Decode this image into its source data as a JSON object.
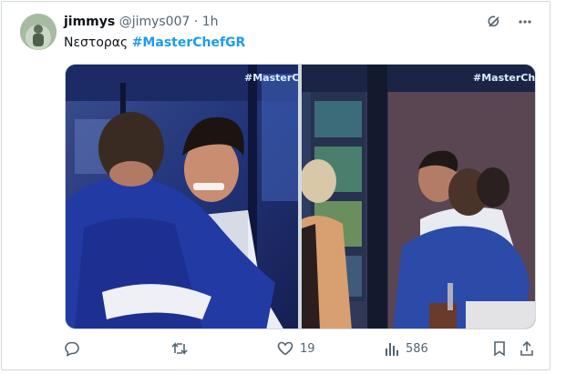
{
  "tweet": {
    "display_name": "jimmys",
    "handle": "@jimys007",
    "separator": "·",
    "time": "1h",
    "text_plain": "Νεστορας ",
    "hashtag": "#MasterChefGR"
  },
  "media": {
    "watermark_left": "#MasterCh",
    "watermark_right": "#MasterChef"
  },
  "actions": {
    "likes": "19",
    "views": "586"
  },
  "icons": {
    "reply": "speech-bubble-icon",
    "retweet": "retweet-icon",
    "like": "heart-icon",
    "views": "bar-chart-icon",
    "bookmark": "bookmark-icon",
    "share": "share-icon",
    "grok": "grok-icon",
    "more": "more-icon"
  }
}
